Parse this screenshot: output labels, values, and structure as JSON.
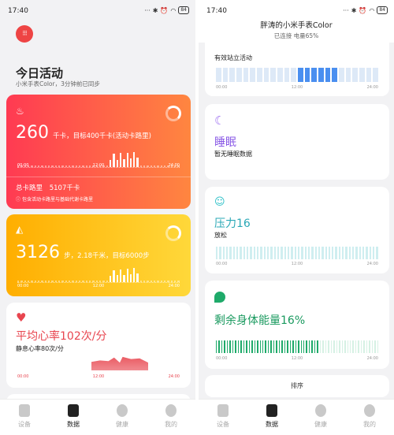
{
  "left": {
    "status": {
      "time": "17:40",
      "battery": "84"
    },
    "title": "今日活动",
    "subtitle": "小米手表Color，3分钟前已同步",
    "calorie_card": {
      "value": "260",
      "unit_text": "千卡，目标400千卡(活动卡路里)",
      "axis": [
        "00:00",
        "12:00",
        "24:00"
      ],
      "total_label": "总卡路里",
      "total_value": "5107千卡",
      "note": "包含活动卡路里与基础代谢卡路里"
    },
    "steps_card": {
      "value": "3126",
      "unit_text": "步，2.18千米，目标6000步",
      "axis": [
        "00:00",
        "12:00",
        "24:00"
      ]
    },
    "heart_card": {
      "title": "平均心率102次/分",
      "subtitle": "静息心率80次/分",
      "axis": [
        "00:00",
        "12:00",
        "24:00"
      ]
    },
    "tabs": [
      "设备",
      "数据",
      "健康",
      "我的"
    ],
    "active_tab": 1
  },
  "right": {
    "status": {
      "time": "17:40",
      "battery": "84"
    },
    "header_title": "胖涛的小米手表Color",
    "header_sub": "已连接  电量65%",
    "stand_card": {
      "label": "有效站立活动",
      "axis": [
        "00:00",
        "12:00",
        "24:00"
      ]
    },
    "sleep_card": {
      "title": "睡眠",
      "subtitle": "暂无睡眠数据"
    },
    "stress_card": {
      "title": "压力16",
      "subtitle": "放松",
      "axis": [
        "00:00",
        "12:00",
        "24:00"
      ]
    },
    "energy_card": {
      "title": "剩余身体能量16%",
      "axis": [
        "00:00",
        "12:00",
        "24:00"
      ]
    },
    "sort_button": "排序",
    "tabs": [
      "设备",
      "数据",
      "健康",
      "我的"
    ],
    "active_tab": 1
  },
  "colors": {
    "calorie_gradient": [
      "#ff3b4e",
      "#ff8a3d"
    ],
    "steps_gradient": [
      "#ffb000",
      "#ffd23a"
    ],
    "heart": "#e8454f",
    "stand": "#4a8ff0",
    "sleep": "#9b6cf0",
    "stress": "#2cc0c8",
    "energy": "#1faa6a"
  }
}
